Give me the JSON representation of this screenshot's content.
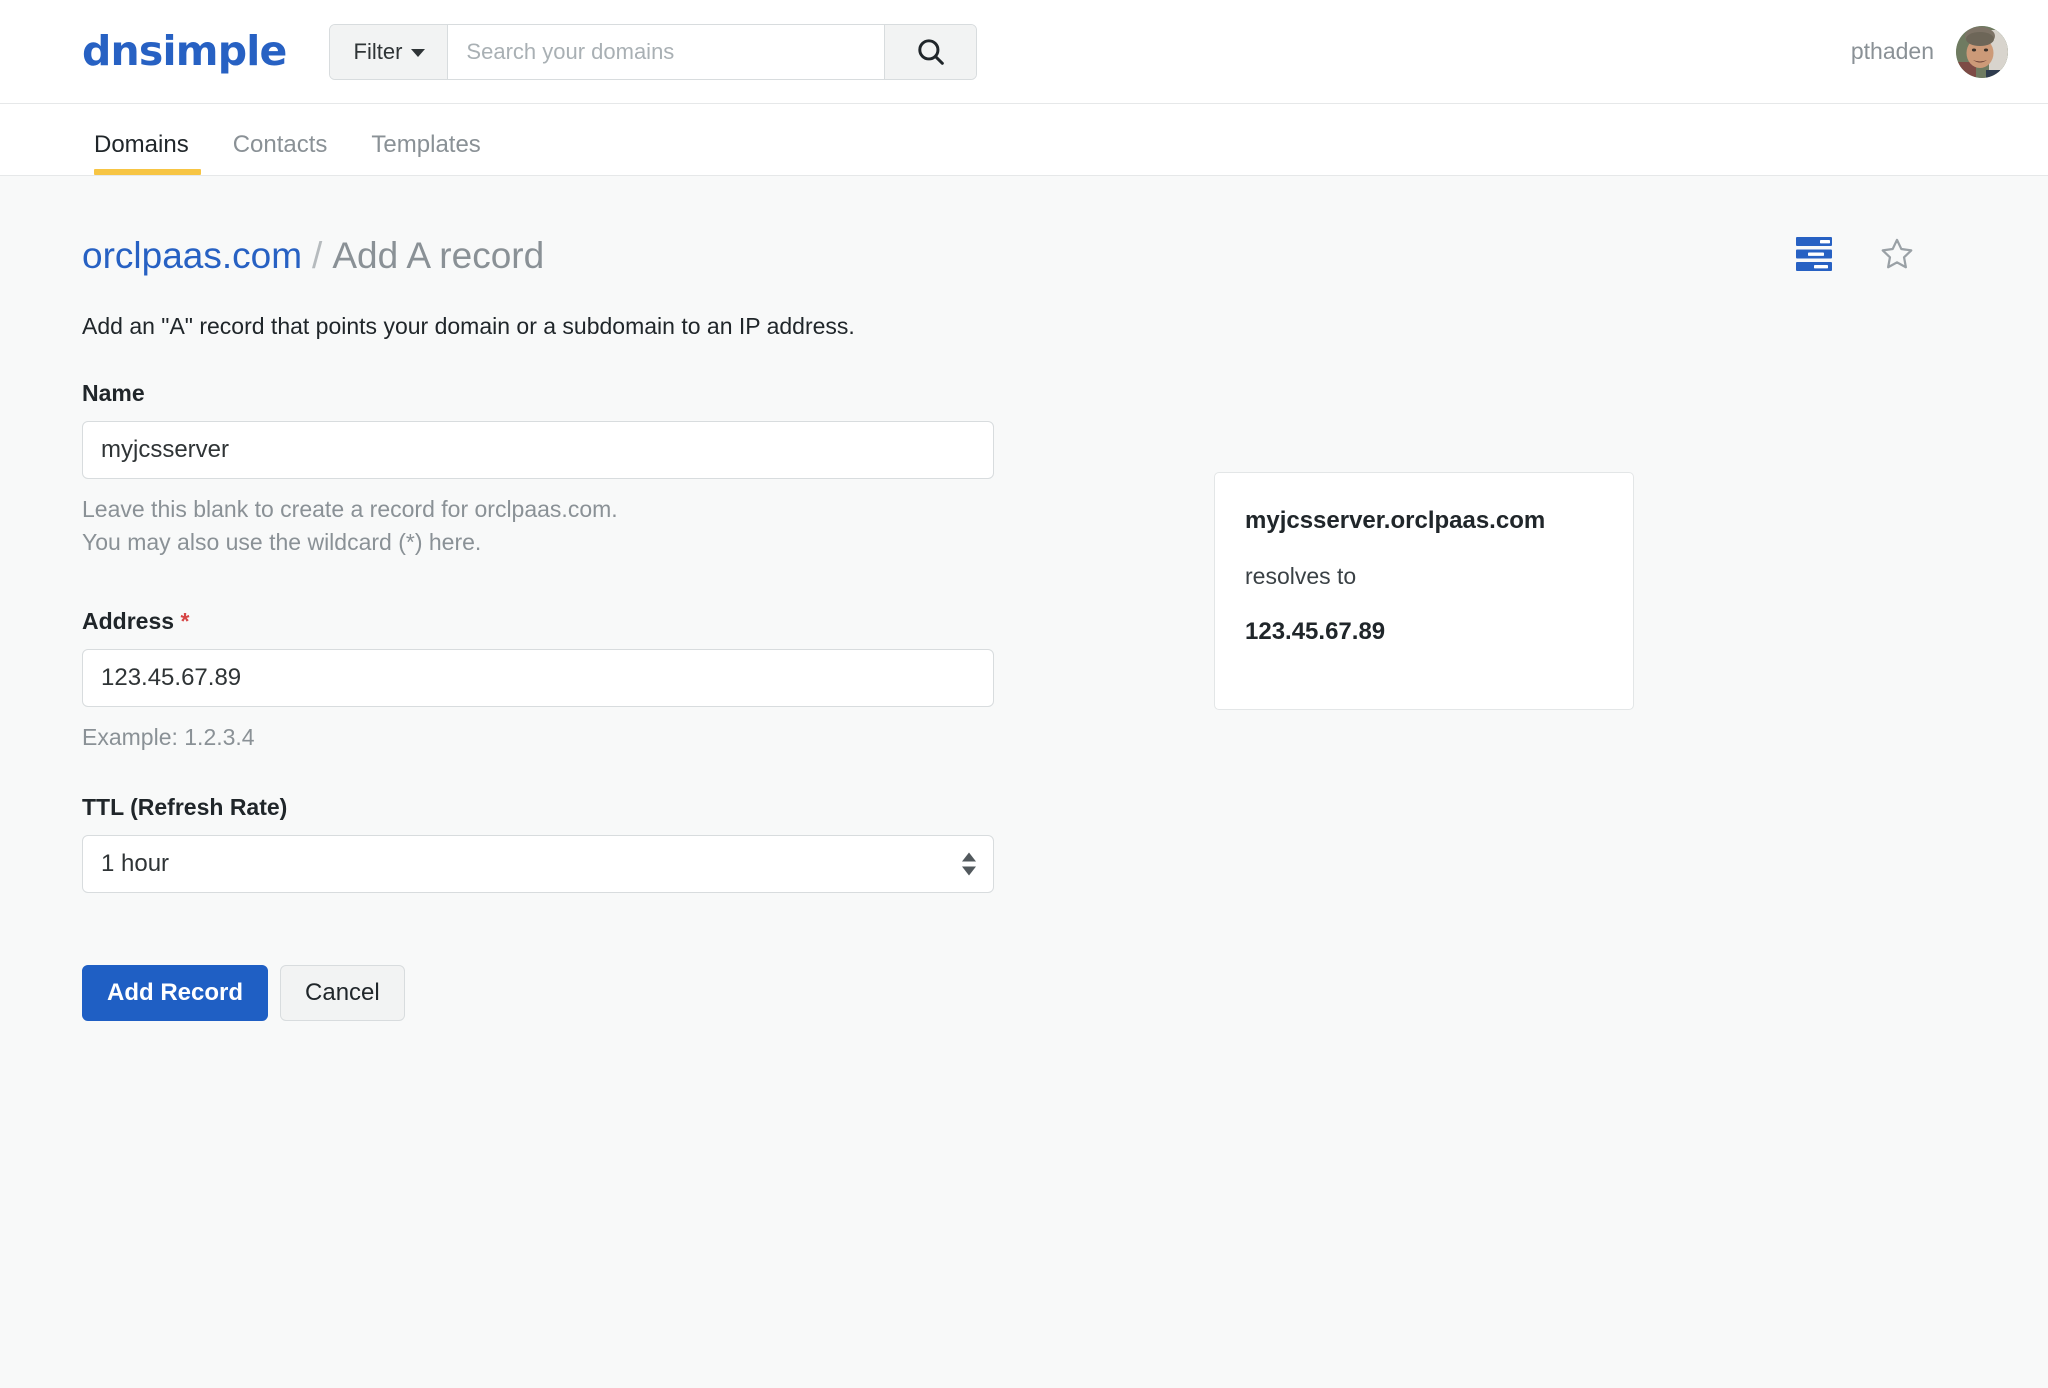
{
  "brand": {
    "logo_text": "dnsimple",
    "logo_color": "#2761c3"
  },
  "header": {
    "filter_label": "Filter",
    "search_placeholder": "Search your domains",
    "search_value": "",
    "search_icon": "search-icon",
    "username": "pthaden"
  },
  "nav": {
    "tabs": [
      {
        "label": "Domains",
        "active": true
      },
      {
        "label": "Contacts",
        "active": false
      },
      {
        "label": "Templates",
        "active": false
      }
    ],
    "active_underline_color": "#f7c544"
  },
  "page": {
    "breadcrumb_domain": "orclpaas.com",
    "breadcrumb_separator": "/",
    "breadcrumb_current": "Add A record",
    "lead": "Add an \"A\" record that points your domain or a subdomain to an IP address.",
    "icons": {
      "records_icon": "server-stack-icon",
      "favorite_icon": "star-outline-icon"
    }
  },
  "form": {
    "name": {
      "label": "Name",
      "value": "myjcsserver",
      "placeholder": "",
      "hint_line1": "Leave this blank to create a record for orclpaas.com.",
      "hint_line2": "You may also use the wildcard (*) here."
    },
    "address": {
      "label": "Address",
      "required_marker": "*",
      "value": "123.45.67.89",
      "placeholder": "",
      "hint": "Example: 1.2.3.4"
    },
    "ttl": {
      "label": "TTL (Refresh Rate)",
      "selected": "1 hour"
    },
    "submit_label": "Add Record",
    "cancel_label": "Cancel",
    "primary_color": "#1f5fc4"
  },
  "preview": {
    "hostname": "myjcsserver.orclpaas.com",
    "middle_text": "resolves to",
    "target": "123.45.67.89"
  }
}
